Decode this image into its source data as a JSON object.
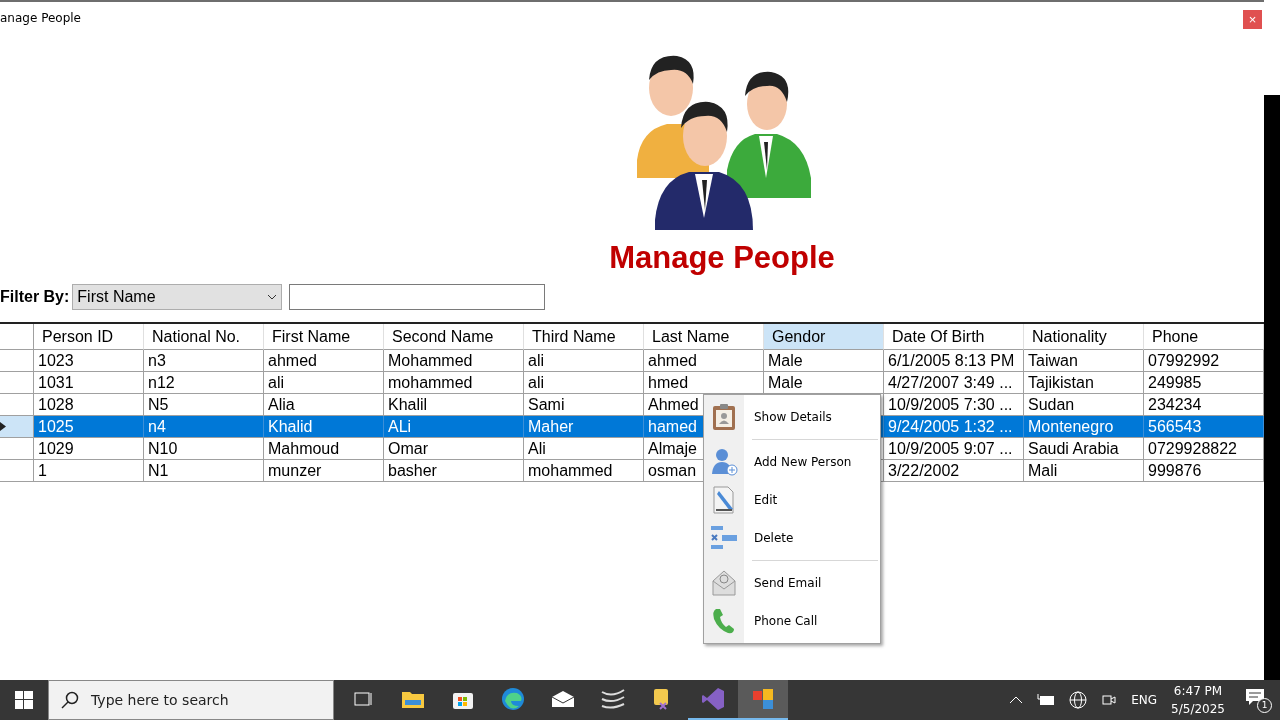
{
  "window": {
    "title": "anage People",
    "close": "×"
  },
  "header": {
    "title": "Manage People"
  },
  "filter": {
    "label": "Filter By:",
    "selected_option": "First Name"
  },
  "table": {
    "columns": [
      {
        "label": "Person ID",
        "highlighted": false
      },
      {
        "label": "National No.",
        "highlighted": false
      },
      {
        "label": "First Name",
        "highlighted": false
      },
      {
        "label": "Second Name",
        "highlighted": false
      },
      {
        "label": "Third Name",
        "highlighted": false
      },
      {
        "label": "Last Name",
        "highlighted": false
      },
      {
        "label": "Gendor",
        "highlighted": true
      },
      {
        "label": "Date Of Birth",
        "highlighted": false
      },
      {
        "label": "Nationality",
        "highlighted": false
      },
      {
        "label": "Phone",
        "highlighted": false
      }
    ],
    "rows": [
      {
        "selected": false,
        "cells": [
          "1023",
          "n3",
          "ahmed",
          "Mohammed",
          "ali",
          "ahmed",
          "Male",
          "6/1/2005 8:13 PM",
          "Taiwan",
          "07992992"
        ]
      },
      {
        "selected": false,
        "cells": [
          "1031",
          "n12",
          "ali",
          "mohammed",
          "ali",
          "hmed",
          "Male",
          "4/27/2007 3:49 ...",
          "Tajikistan",
          "249985"
        ]
      },
      {
        "selected": false,
        "cells": [
          "1028",
          "N5",
          "Alia",
          "Khalil",
          "Sami",
          "Ahmed",
          null,
          "10/9/2005 7:30 ...",
          "Sudan",
          "234234"
        ]
      },
      {
        "selected": true,
        "cells": [
          "1025",
          "n4",
          "Khalid",
          "ALi",
          "Maher",
          "hamed",
          null,
          "9/24/2005 1:32 ...",
          "Montenegro",
          "566543"
        ]
      },
      {
        "selected": false,
        "cells": [
          "1029",
          "N10",
          "Mahmoud",
          "Omar",
          "Ali",
          "Almaje",
          null,
          "10/9/2005 9:07 ...",
          "Saudi Arabia",
          "0729928822"
        ]
      },
      {
        "selected": false,
        "cells": [
          "1",
          "N1",
          "munzer",
          "basher",
          "mohammed",
          "osman",
          null,
          "3/22/2002",
          "Mali",
          "999876"
        ]
      }
    ]
  },
  "context_menu": {
    "items": [
      {
        "kind": "item",
        "label": "Show Details"
      },
      {
        "kind": "separator"
      },
      {
        "kind": "item",
        "label": "Add New Person"
      },
      {
        "kind": "item",
        "label": "Edit"
      },
      {
        "kind": "item",
        "label": "Delete"
      },
      {
        "kind": "separator"
      },
      {
        "kind": "item",
        "label": "Send Email"
      },
      {
        "kind": "item",
        "label": "Phone Call"
      }
    ]
  },
  "taskbar": {
    "search_placeholder": "Type here to search",
    "apps": [
      {
        "running": false,
        "active": false
      },
      {
        "running": false,
        "active": false
      },
      {
        "running": false,
        "active": false
      },
      {
        "running": false,
        "active": false
      },
      {
        "running": false,
        "active": false
      },
      {
        "running": false,
        "active": false
      },
      {
        "running": false,
        "active": false
      },
      {
        "running": true,
        "active": false
      },
      {
        "running": true,
        "active": true
      }
    ],
    "language": "ENG",
    "time": "6:47 PM",
    "date": "5/5/2025",
    "notifications": "1"
  }
}
